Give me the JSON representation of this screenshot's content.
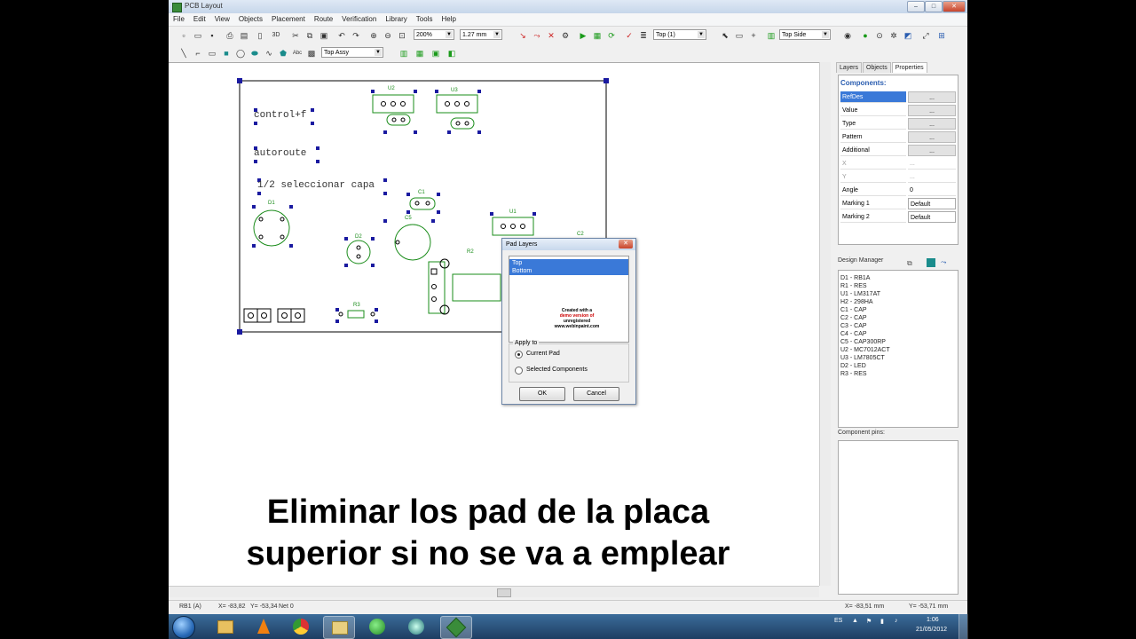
{
  "window": {
    "title": "PCB Layout"
  },
  "menu": [
    "File",
    "Edit",
    "View",
    "Objects",
    "Placement",
    "Route",
    "Verification",
    "Library",
    "Tools",
    "Help"
  ],
  "toolbar": {
    "zoom": "200%",
    "grid": "1.27 mm",
    "layer": "Top (1)",
    "side": "Top Side",
    "assy": "Top Assy"
  },
  "canvas": {
    "texts": [
      "control+f",
      "autoroute",
      "1/2 seleccionar capa"
    ],
    "refs": [
      "U2",
      "U3",
      "C1",
      "D1",
      "C5",
      "D2",
      "U1",
      "C2",
      "R2",
      "R3"
    ]
  },
  "panel": {
    "tabs": [
      "Layers",
      "Objects",
      "Properties"
    ],
    "components_header": "Components:",
    "properties": [
      {
        "key": "RefDes",
        "value": "..."
      },
      {
        "key": "Value",
        "value": "..."
      },
      {
        "key": "Type",
        "value": "..."
      },
      {
        "key": "Pattern",
        "value": "..."
      },
      {
        "key": "Additional",
        "value": "..."
      },
      {
        "key": "X",
        "value": "..."
      },
      {
        "key": "Y",
        "value": "..."
      },
      {
        "key": "Angle",
        "value": "0"
      },
      {
        "key": "Marking 1",
        "value": "Default"
      },
      {
        "key": "Marking 2",
        "value": "Default"
      }
    ],
    "design_manager": "Design Manager",
    "dm_items": [
      "D1 - RB1A",
      "R1 - RES",
      "U1 - LM317AT",
      "H2 - 298HA",
      "C1 - CAP",
      "C2 - CAP",
      "C3 - CAP",
      "C4 - CAP",
      "C5 - CAP300RP",
      "U2 - MC7012ACT",
      "U3 - LM7805CT",
      "D2 - LED",
      "R3 - RES"
    ],
    "component_pins": "Component pins:"
  },
  "dialog": {
    "title": "Pad Layers",
    "layers": [
      "Top",
      "Bottom"
    ],
    "watermark": [
      "Created with a",
      "demo version of",
      "unregistered",
      "www.webinpaint.com"
    ],
    "apply_to": "Apply to",
    "options": [
      "Current Pad",
      "Selected Components"
    ],
    "ok": "OK",
    "cancel": "Cancel"
  },
  "status": {
    "ref": "RB1 (A)",
    "x": "X= -83,82",
    "y": "Y= -53,34",
    "net": "Net 0",
    "rx": "X= -83,51 mm",
    "ry": "Y= -53,71 mm"
  },
  "subtitle": {
    "line1": "Eliminar los pad de la placa",
    "line2": "superior si no se va a emplear"
  },
  "taskbar": {
    "lang": "ES",
    "time": "1:06",
    "date": "21/05/2012"
  }
}
